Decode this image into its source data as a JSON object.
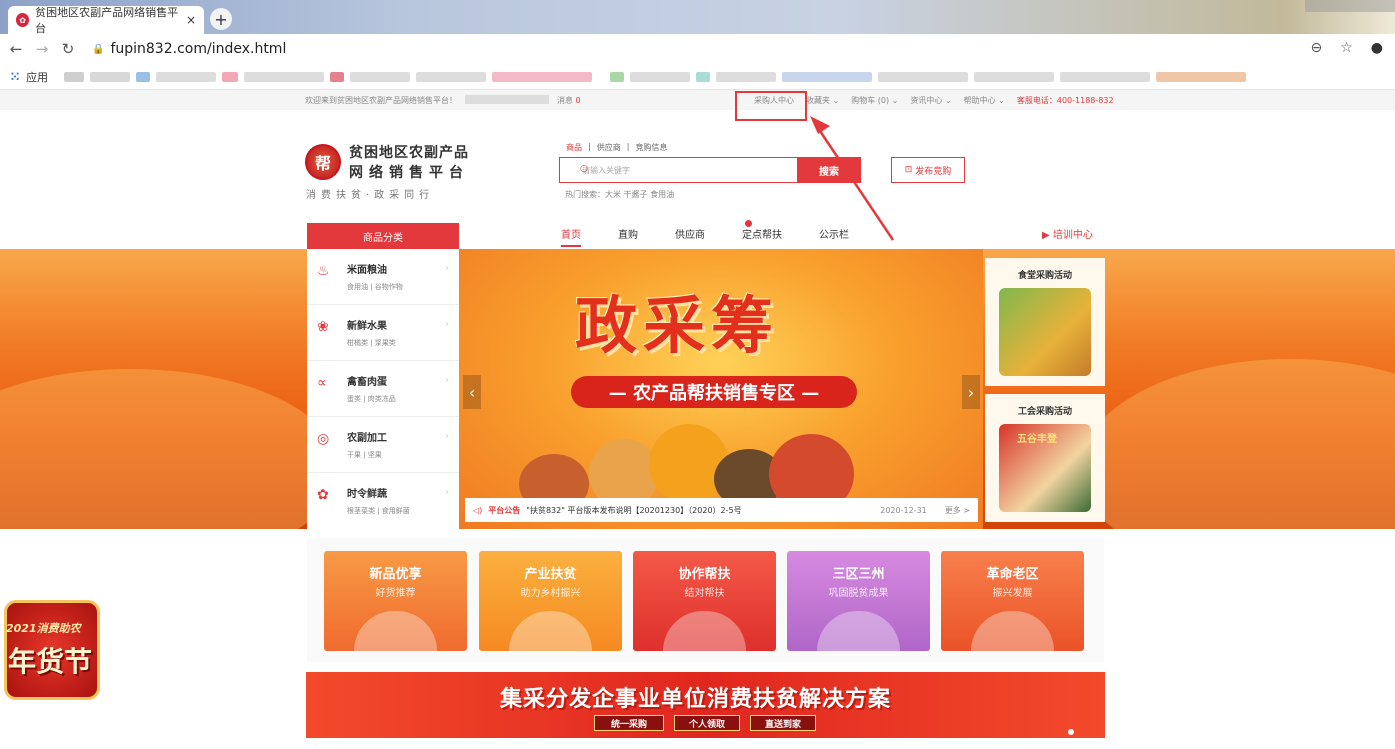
{
  "browser": {
    "tab_title": "贫困地区农副产品网络销售平台",
    "tab_close": "×",
    "new_tab": "+",
    "url": "fupin832.com/index.html",
    "apps_label": "应用",
    "icons": [
      "back-icon",
      "forward-icon",
      "reload-icon",
      "lock-icon",
      "zoom-icon",
      "star-icon",
      "profile-icon",
      "apps-icon"
    ]
  },
  "topbar": {
    "welcome": "欢迎来到贫困地区农副产品网络销售平台！",
    "messages_label": "消息",
    "messages_count": "0",
    "links": [
      {
        "label": "采购人中心",
        "key": "buyer_center"
      },
      {
        "label": "收藏夹 ⌄"
      },
      {
        "label": "购物车 (0) ⌄"
      },
      {
        "label": "资讯中心 ⌄"
      },
      {
        "label": "帮助中心 ⌄"
      }
    ],
    "hotline": "客服电话：400-1188-832"
  },
  "header": {
    "logo_line1": "贫困地区农副产品",
    "logo_line2": "网络销售平台",
    "slogan": "消费扶贫·政采同行",
    "search_tabs": [
      "商品",
      "供应商",
      "竞购信息"
    ],
    "search_placeholder": "请输入关键字",
    "search_button": "搜索",
    "hot_search": "热门搜索：大米  干酱子  食用油",
    "publish_button": "发布竞购"
  },
  "nav": {
    "category_title": "商品分类",
    "items": [
      "首页",
      "直购",
      "供应商",
      "定点帮扶",
      "公示栏"
    ],
    "training": "培训中心"
  },
  "categories": [
    {
      "name": "米面粮油",
      "sub": "食用油 | 谷物作物",
      "icon": "bottle-icon"
    },
    {
      "name": "新鲜水果",
      "sub": "柑橘类 | 浆果类",
      "icon": "fruit-icon"
    },
    {
      "name": "禽畜肉蛋",
      "sub": "蛋类 | 肉类冻品",
      "icon": "meat-icon"
    },
    {
      "name": "农副加工",
      "sub": "干果 | 坚果",
      "icon": "nut-icon"
    },
    {
      "name": "时令鲜蔬",
      "sub": "根茎菜类 | 食用鲜菌",
      "icon": "vegetable-icon"
    }
  ],
  "banner": {
    "headline": "政采筹",
    "subline": "— 农产品帮扶销售专区 —",
    "prev": "‹",
    "next": "›"
  },
  "notice": {
    "label": "平台公告",
    "text": "\"扶贫832\" 平台版本发布说明【20201230】（2020）2-5号",
    "date": "2020-12-31",
    "more": "更多 >"
  },
  "promos": [
    {
      "title": "食堂采购活动"
    },
    {
      "title": "工会采购活动",
      "img_text": "五谷丰登"
    }
  ],
  "tiles": [
    {
      "title": "新品优享",
      "sub": "好货推荐",
      "color": "#f6893a"
    },
    {
      "title": "产业扶贫",
      "sub": "助力乡村振兴",
      "color": "#f8a433"
    },
    {
      "title": "协作帮扶",
      "sub": "结对帮扶",
      "color": "#ee4a3c"
    },
    {
      "title": "三区三州",
      "sub": "巩固脱贫成果",
      "color": "#c77ad6"
    },
    {
      "title": "革命老区",
      "sub": "振兴发展",
      "color": "#f26b3e"
    }
  ],
  "bottom_banner": {
    "title": "集采分发企事业单位消费扶贫解决方案",
    "buttons": [
      "统一采购",
      "个人领取",
      "直送到家"
    ]
  },
  "festival": {
    "line1": "2021消费助农",
    "line2": "年货节"
  },
  "colors": {
    "brand_red": "#e4393c",
    "annotation_red": "#e4393c"
  }
}
